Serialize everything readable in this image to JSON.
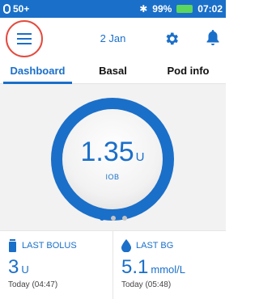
{
  "statusbar": {
    "pod_level": "50+",
    "battery_percent": "99%",
    "time": "07:02",
    "battery_color": "#5cd65c"
  },
  "header": {
    "date": "2 Jan",
    "icons": [
      "menu-icon",
      "gear-icon",
      "bell-icon"
    ]
  },
  "tabs": [
    {
      "label": "Dashboard",
      "active": true
    },
    {
      "label": "Basal",
      "active": false
    },
    {
      "label": "Pod info",
      "active": false
    }
  ],
  "iob": {
    "value": "1.35",
    "unit": "U",
    "label": "IOB"
  },
  "pager": {
    "count": 3,
    "active_index": 0
  },
  "last_bolus": {
    "label": "LAST BOLUS",
    "value": "3",
    "unit": "U",
    "time": "Today (04:47)"
  },
  "last_bg": {
    "label": "LAST BG",
    "value": "5.1",
    "unit": "mmol/L",
    "time": "Today (05:48)"
  },
  "colors": {
    "primary": "#1a6fc9",
    "highlight_circle": "#e34b3e"
  }
}
